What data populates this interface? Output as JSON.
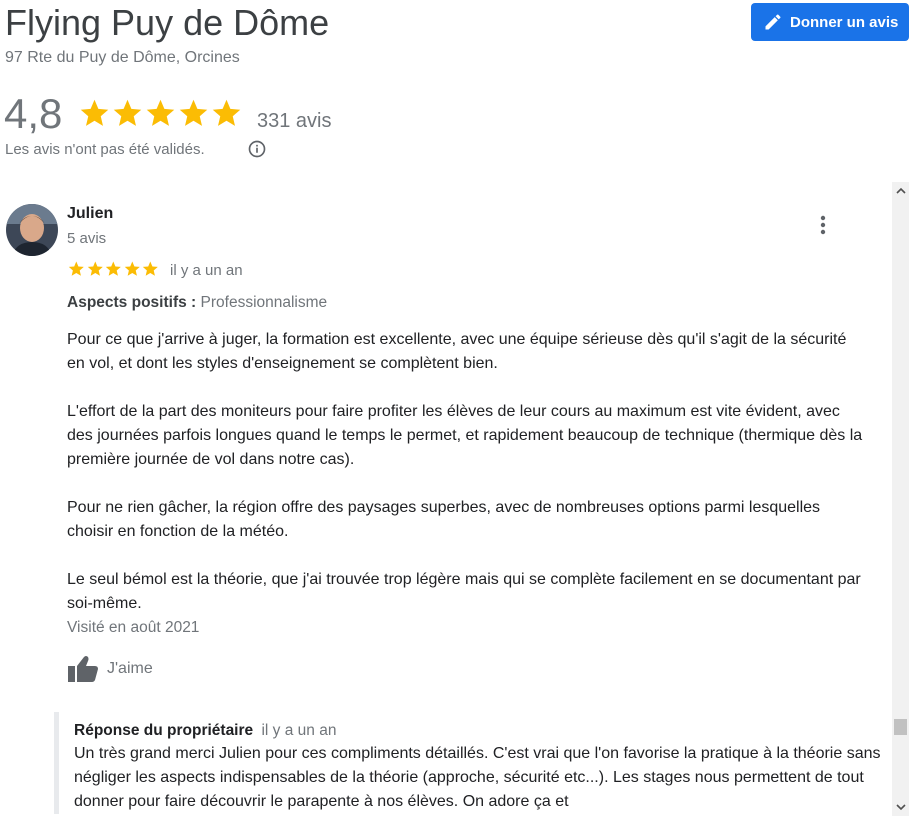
{
  "place": {
    "name": "Flying Puy de Dôme",
    "address": "97 Rte du Puy de Dôme, Orcines",
    "rating": "4,8",
    "rating_value": 4.8,
    "review_count": "331 avis",
    "unverified_note": "Les avis n'ont pas été validés."
  },
  "actions": {
    "write_review_label": "Donner un avis"
  },
  "review": {
    "author": "Julien",
    "author_reviews": "5 avis",
    "stars": 5,
    "date": "il y a un an",
    "aspects_label": "Aspects positifs :",
    "aspects_value": "Professionnalisme",
    "paragraphs": [
      "Pour ce que j'arrive à juger, la formation est excellente, avec une équipe sérieuse dès qu'il s'agit de la sécurité en vol, et dont les styles d'enseignement se complètent bien.",
      "L'effort de la part des moniteurs pour faire profiter les élèves de leur cours au maximum est vite évident, avec des journées parfois longues quand le temps le permet, et rapidement beaucoup de technique (thermique dès la première journée de vol dans notre cas).",
      "Pour ne rien gâcher, la région offre des paysages superbes, avec de nombreuses options parmi lesquelles choisir en fonction de la météo.",
      "Le seul bémol est la théorie, que j'ai trouvée trop légère mais qui se complète facilement en se documentant par soi-même."
    ],
    "visited": "Visité en août 2021",
    "like_label": "J'aime"
  },
  "owner_reply": {
    "label": "Réponse du propriétaire",
    "date": "il y a un an",
    "text": "Un très grand merci Julien pour ces compliments détaillés. C'est vrai que l'on favorise la pratique à la théorie sans négliger les aspects indispensables de la théorie (approche, sécurité etc...). Les stages nous permettent de tout donner pour faire découvrir le parapente à nos élèves. On adore ça et"
  },
  "colors": {
    "star": "#fbbc04",
    "accent": "#1a73e8",
    "muted_text": "#70757a"
  },
  "icons": [
    "edit-pencil-icon",
    "star-icon",
    "info-icon",
    "more-vert-icon",
    "thumb-up-icon",
    "scroll-up-icon",
    "scroll-down-icon"
  ]
}
